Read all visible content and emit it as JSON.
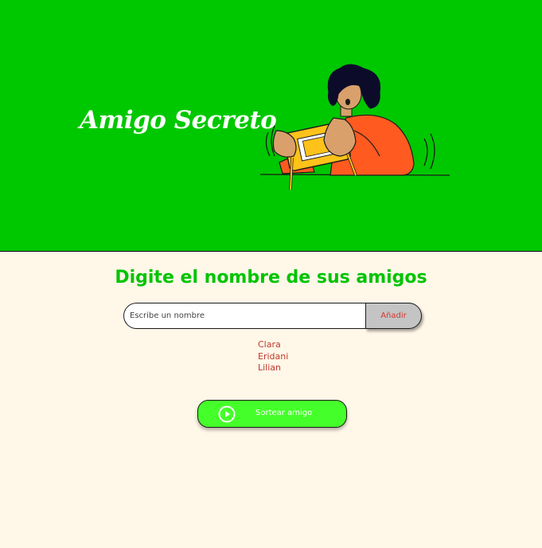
{
  "hero": {
    "title": "Amigo Secreto",
    "illustration_icon": "person-playing-handheld-console-illustration"
  },
  "main": {
    "heading": "Digite el nombre de sus amigos",
    "input": {
      "placeholder": "Escribe un nombre",
      "value": ""
    },
    "add_button": {
      "label": "Añadir"
    },
    "friends": [
      "Clara",
      "Eridani",
      "Lilian"
    ],
    "draw_button": {
      "label": "Sortear amigo",
      "icon": "play-circle-icon"
    }
  },
  "colors": {
    "hero_background": "#00c800",
    "page_background": "#fff7e8",
    "heading": "#00c400",
    "friend_text": "#c0392b",
    "add_button_background": "#c4c4c4",
    "add_button_text": "#d1382f",
    "draw_button_background": "#45ff2a"
  }
}
